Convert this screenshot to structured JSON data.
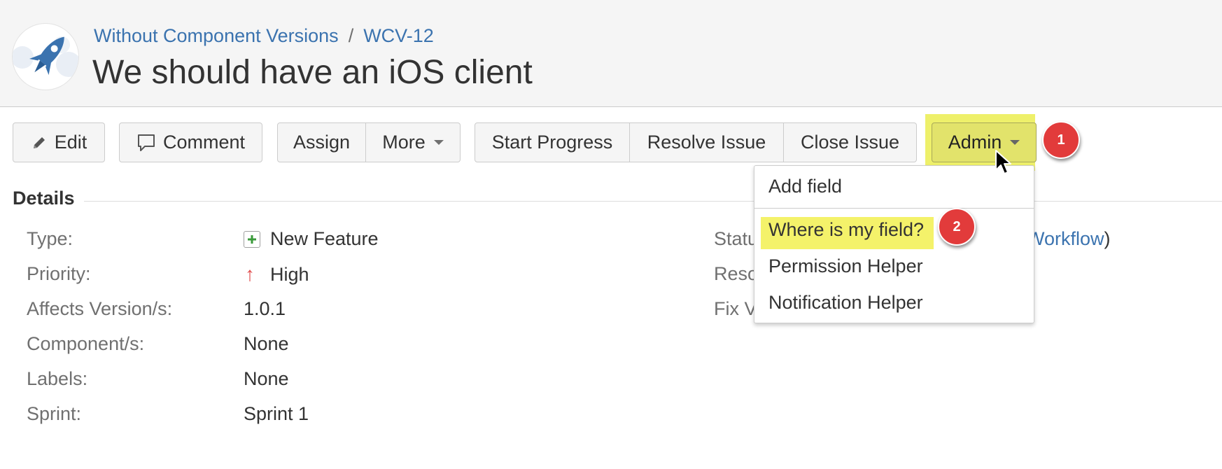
{
  "header": {
    "breadcrumb": {
      "project": "Without Component Versions",
      "separator": "/",
      "issue_key": "WCV-12"
    },
    "title": "We should have an iOS client",
    "avatar_icon": "rocket-icon"
  },
  "toolbar": {
    "edit_label": "Edit",
    "comment_label": "Comment",
    "assign_label": "Assign",
    "more_label": "More",
    "start_progress_label": "Start Progress",
    "resolve_issue_label": "Resolve Issue",
    "close_issue_label": "Close Issue",
    "admin_label": "Admin"
  },
  "admin_menu": {
    "items": [
      {
        "label": "Add field"
      },
      {
        "label": "Where is my field?"
      },
      {
        "label": "Permission Helper"
      },
      {
        "label": "Notification Helper"
      }
    ]
  },
  "annotations": {
    "badge1": "1",
    "badge2": "2",
    "highlight_color": "#f4f26a",
    "badge_color": "#e23b3b"
  },
  "details": {
    "heading": "Details",
    "left": [
      {
        "label": "Type:",
        "value": "New Feature",
        "icon": "new-feature-icon"
      },
      {
        "label": "Priority:",
        "value": "High",
        "icon": "priority-high-icon"
      },
      {
        "label": "Affects Version/s:",
        "value": "1.0.1"
      },
      {
        "label": "Component/s:",
        "value": "None"
      },
      {
        "label": "Labels:",
        "value": "None"
      },
      {
        "label": "Sprint:",
        "value": "Sprint 1"
      }
    ],
    "right_labels_visible": [
      "Statu",
      "Reso",
      "Fix V"
    ],
    "workflow_link_text": "w Workflow",
    "workflow_close_paren": ")"
  },
  "colors": {
    "link": "#3b73af",
    "header_bg": "#f5f5f5",
    "admin_highlight": "#eef06a"
  }
}
